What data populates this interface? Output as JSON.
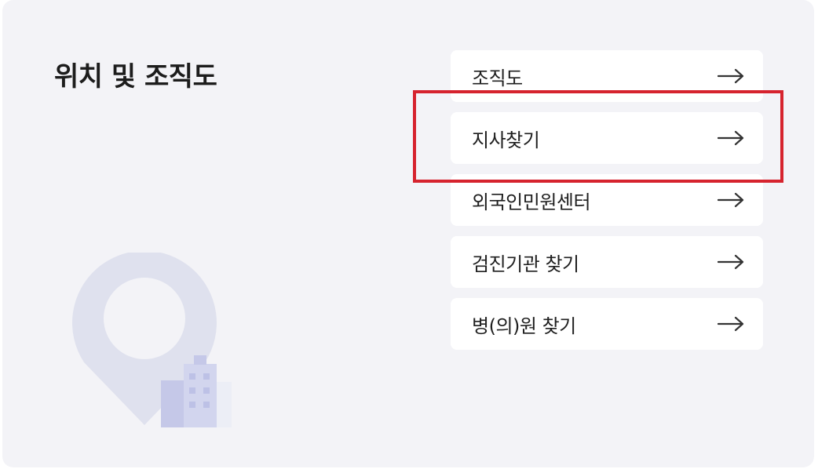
{
  "section": {
    "title": "위치 및 조직도"
  },
  "menu": {
    "items": [
      {
        "label": "조직도",
        "icon": "arrow-right-icon"
      },
      {
        "label": "지사찾기",
        "icon": "arrow-right-icon"
      },
      {
        "label": "외국인민원센터",
        "icon": "arrow-right-icon"
      },
      {
        "label": "검진기관 찾기",
        "icon": "arrow-right-icon"
      },
      {
        "label": "병(의)원 찾기",
        "icon": "arrow-right-icon"
      }
    ],
    "highlighted_item": "지사찾기"
  },
  "illustration": {
    "icon": "location-pin-building-icon"
  },
  "colors": {
    "panel_background": "#f3f3f7",
    "item_background": "#ffffff",
    "highlight_border": "#d6232e",
    "text": "#1f1f1f",
    "pin": "#dfe1ee",
    "building": "#c5c8e8"
  }
}
